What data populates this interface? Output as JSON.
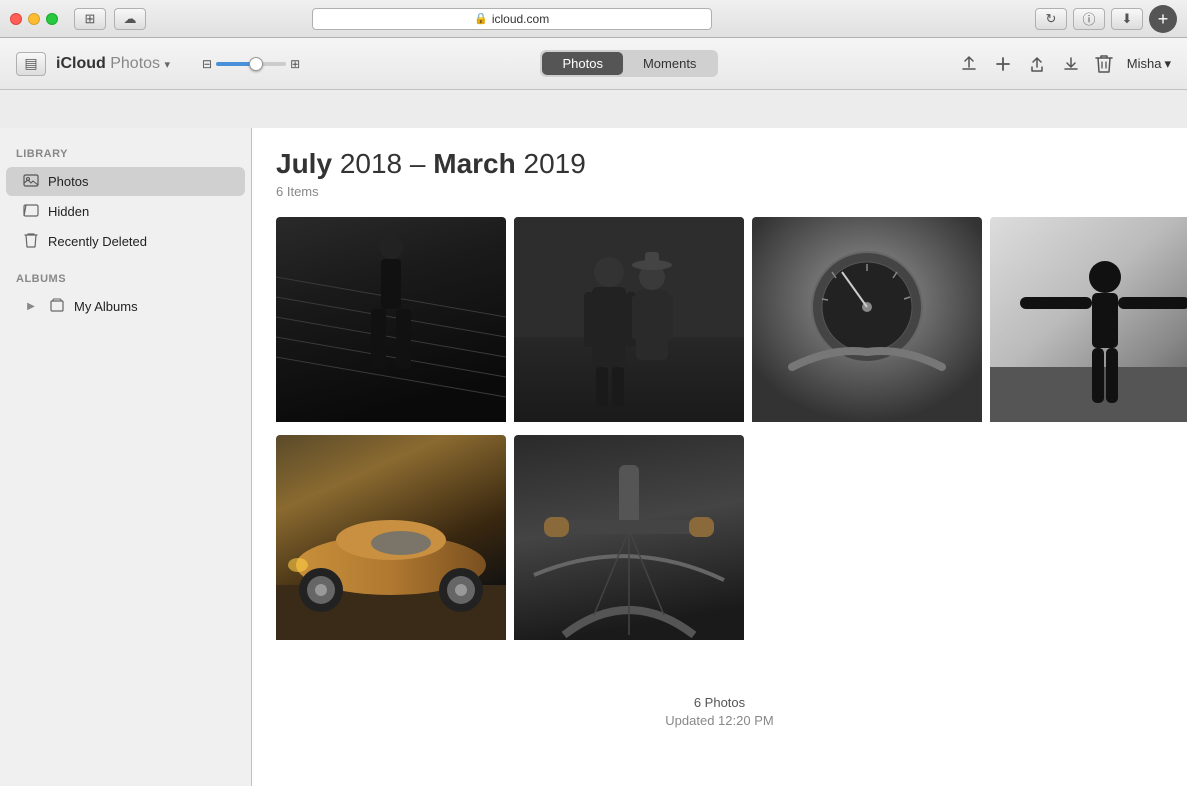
{
  "titlebar": {
    "url": "icloud.com",
    "new_tab_label": "+",
    "btn_sidebar": "⊞",
    "btn_icloud": "☁",
    "btn_reload": "↻",
    "btn_info": "ⓘ",
    "btn_download": "⬇"
  },
  "toolbar": {
    "app_brand": "iCloud",
    "app_product": "Photos",
    "app_chevron": "▾",
    "sidebar_toggle_icon": "▤",
    "zoom_small_icon": "⊟",
    "zoom_large_icon": "⊞",
    "tabs": [
      {
        "label": "Photos",
        "active": true
      },
      {
        "label": "Moments",
        "active": false
      }
    ],
    "upload_icon": "⬆",
    "add_icon": "+",
    "share_icon": "⬆",
    "download_icon": "⬇",
    "delete_icon": "🗑",
    "user_name": "Misha",
    "user_chevron": "▾"
  },
  "sidebar": {
    "library_label": "Library",
    "albums_label": "Albums",
    "items": [
      {
        "id": "photos",
        "label": "Photos",
        "icon": "📷",
        "active": true
      },
      {
        "id": "hidden",
        "label": "Hidden",
        "icon": "⊟"
      },
      {
        "id": "recently-deleted",
        "label": "Recently Deleted",
        "icon": "🗑"
      }
    ],
    "my_albums_label": "My Albums",
    "my_albums_icon": "▶"
  },
  "content": {
    "date_start_month": "July",
    "date_start_year": "2018",
    "date_separator": "–",
    "date_end_month": "March",
    "date_end_year": "2019",
    "items_count": "6 Items",
    "footer_count": "6 Photos",
    "footer_updated": "Updated 12:20 PM"
  },
  "photos": [
    {
      "id": 1,
      "style": "bw-stairs",
      "colors": [
        "#1a1a1a",
        "#2a2a2a",
        "#3a3a3a",
        "#0a0a0a"
      ]
    },
    {
      "id": 2,
      "style": "bw-couple",
      "colors": [
        "#2a2a2a",
        "#3a3a3a",
        "#1a1a1a",
        "#444"
      ]
    },
    {
      "id": 3,
      "style": "bw-motorcycle",
      "colors": [
        "#666",
        "#777",
        "#555",
        "#888"
      ]
    },
    {
      "id": 4,
      "style": "bw-man-arms",
      "colors": [
        "#bbb",
        "#aaa",
        "#888",
        "#333"
      ]
    },
    {
      "id": 5,
      "style": "color-car",
      "colors": [
        "#7a5c2a",
        "#9a7c3a",
        "#4a3010",
        "#222"
      ]
    },
    {
      "id": 6,
      "style": "bw-bicycle",
      "colors": [
        "#333",
        "#555",
        "#222",
        "#444"
      ]
    }
  ]
}
